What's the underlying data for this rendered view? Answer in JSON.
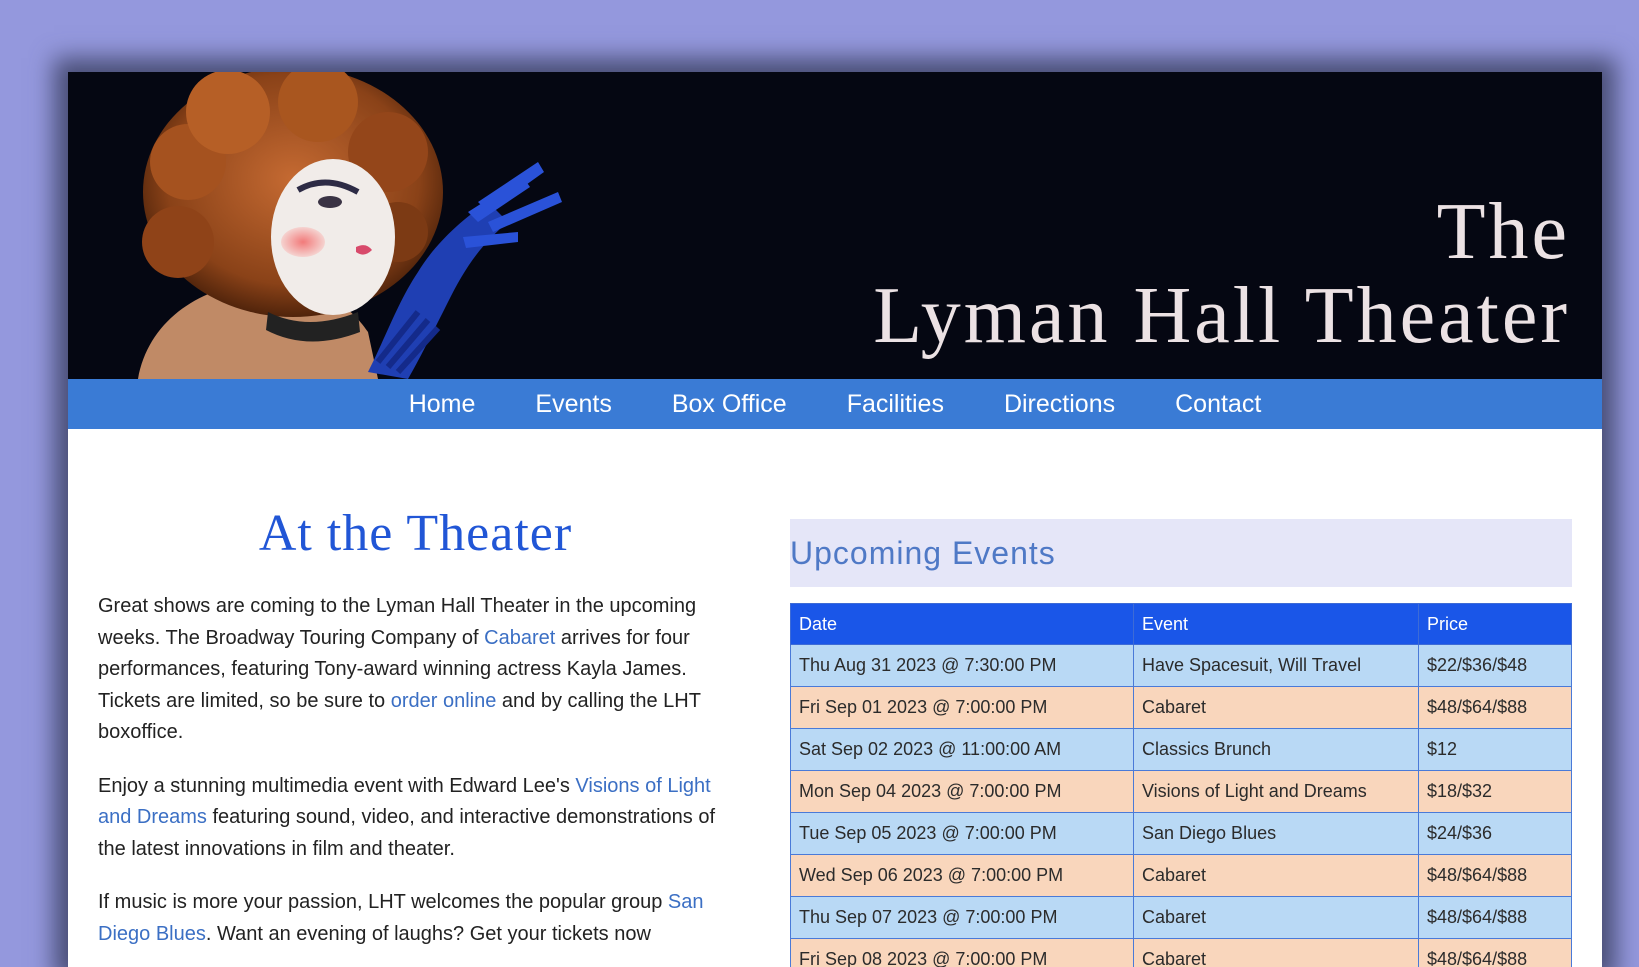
{
  "banner": {
    "title_line1": "The",
    "title_line2": "Lyman Hall Theater"
  },
  "nav": [
    "Home",
    "Events",
    "Box Office",
    "Facilities",
    "Directions",
    "Contact"
  ],
  "main": {
    "heading": "At the Theater",
    "p1": {
      "t1": "Great shows are coming to the Lyman Hall Theater in the upcoming weeks. The Broadway Touring Company of ",
      "link1": "Cabaret",
      "t2": " arrives for four performances, featuring Tony-award winning actress Kayla James. Tickets are limited, so be sure to ",
      "link2": "order online",
      "t3": " and by calling the LHT boxoffice."
    },
    "p2": {
      "t1": "Enjoy a stunning multimedia event with Edward Lee's ",
      "link1": "Visions of Light and Dreams",
      "t2": " featuring sound, video, and interactive demonstrations of the latest innovations in film and theater."
    },
    "p3": {
      "t1": "If music is more your passion, LHT welcomes the popular group ",
      "link1": "San Diego Blues",
      "t2": ". Want an evening of laughs? Get your tickets now"
    }
  },
  "events": {
    "heading": "Upcoming Events",
    "columns": [
      "Date",
      "Event",
      "Price"
    ],
    "rows": [
      [
        "Thu Aug 31 2023 @ 7:30:00 PM",
        "Have Spacesuit, Will Travel",
        "$22/$36/$48"
      ],
      [
        "Fri Sep 01 2023 @ 7:00:00 PM",
        "Cabaret",
        "$48/$64/$88"
      ],
      [
        "Sat Sep 02 2023 @ 11:00:00 AM",
        "Classics Brunch",
        "$12"
      ],
      [
        "Mon Sep 04 2023 @ 7:00:00 PM",
        "Visions of Light and Dreams",
        "$18/$32"
      ],
      [
        "Tue Sep 05 2023 @ 7:00:00 PM",
        "San Diego Blues",
        "$24/$36"
      ],
      [
        "Wed Sep 06 2023 @ 7:00:00 PM",
        "Cabaret",
        "$48/$64/$88"
      ],
      [
        "Thu Sep 07 2023 @ 7:00:00 PM",
        "Cabaret",
        "$48/$64/$88"
      ],
      [
        "Fri Sep 08 2023 @ 7:00:00 PM",
        "Cabaret",
        "$48/$64/$88"
      ]
    ]
  }
}
